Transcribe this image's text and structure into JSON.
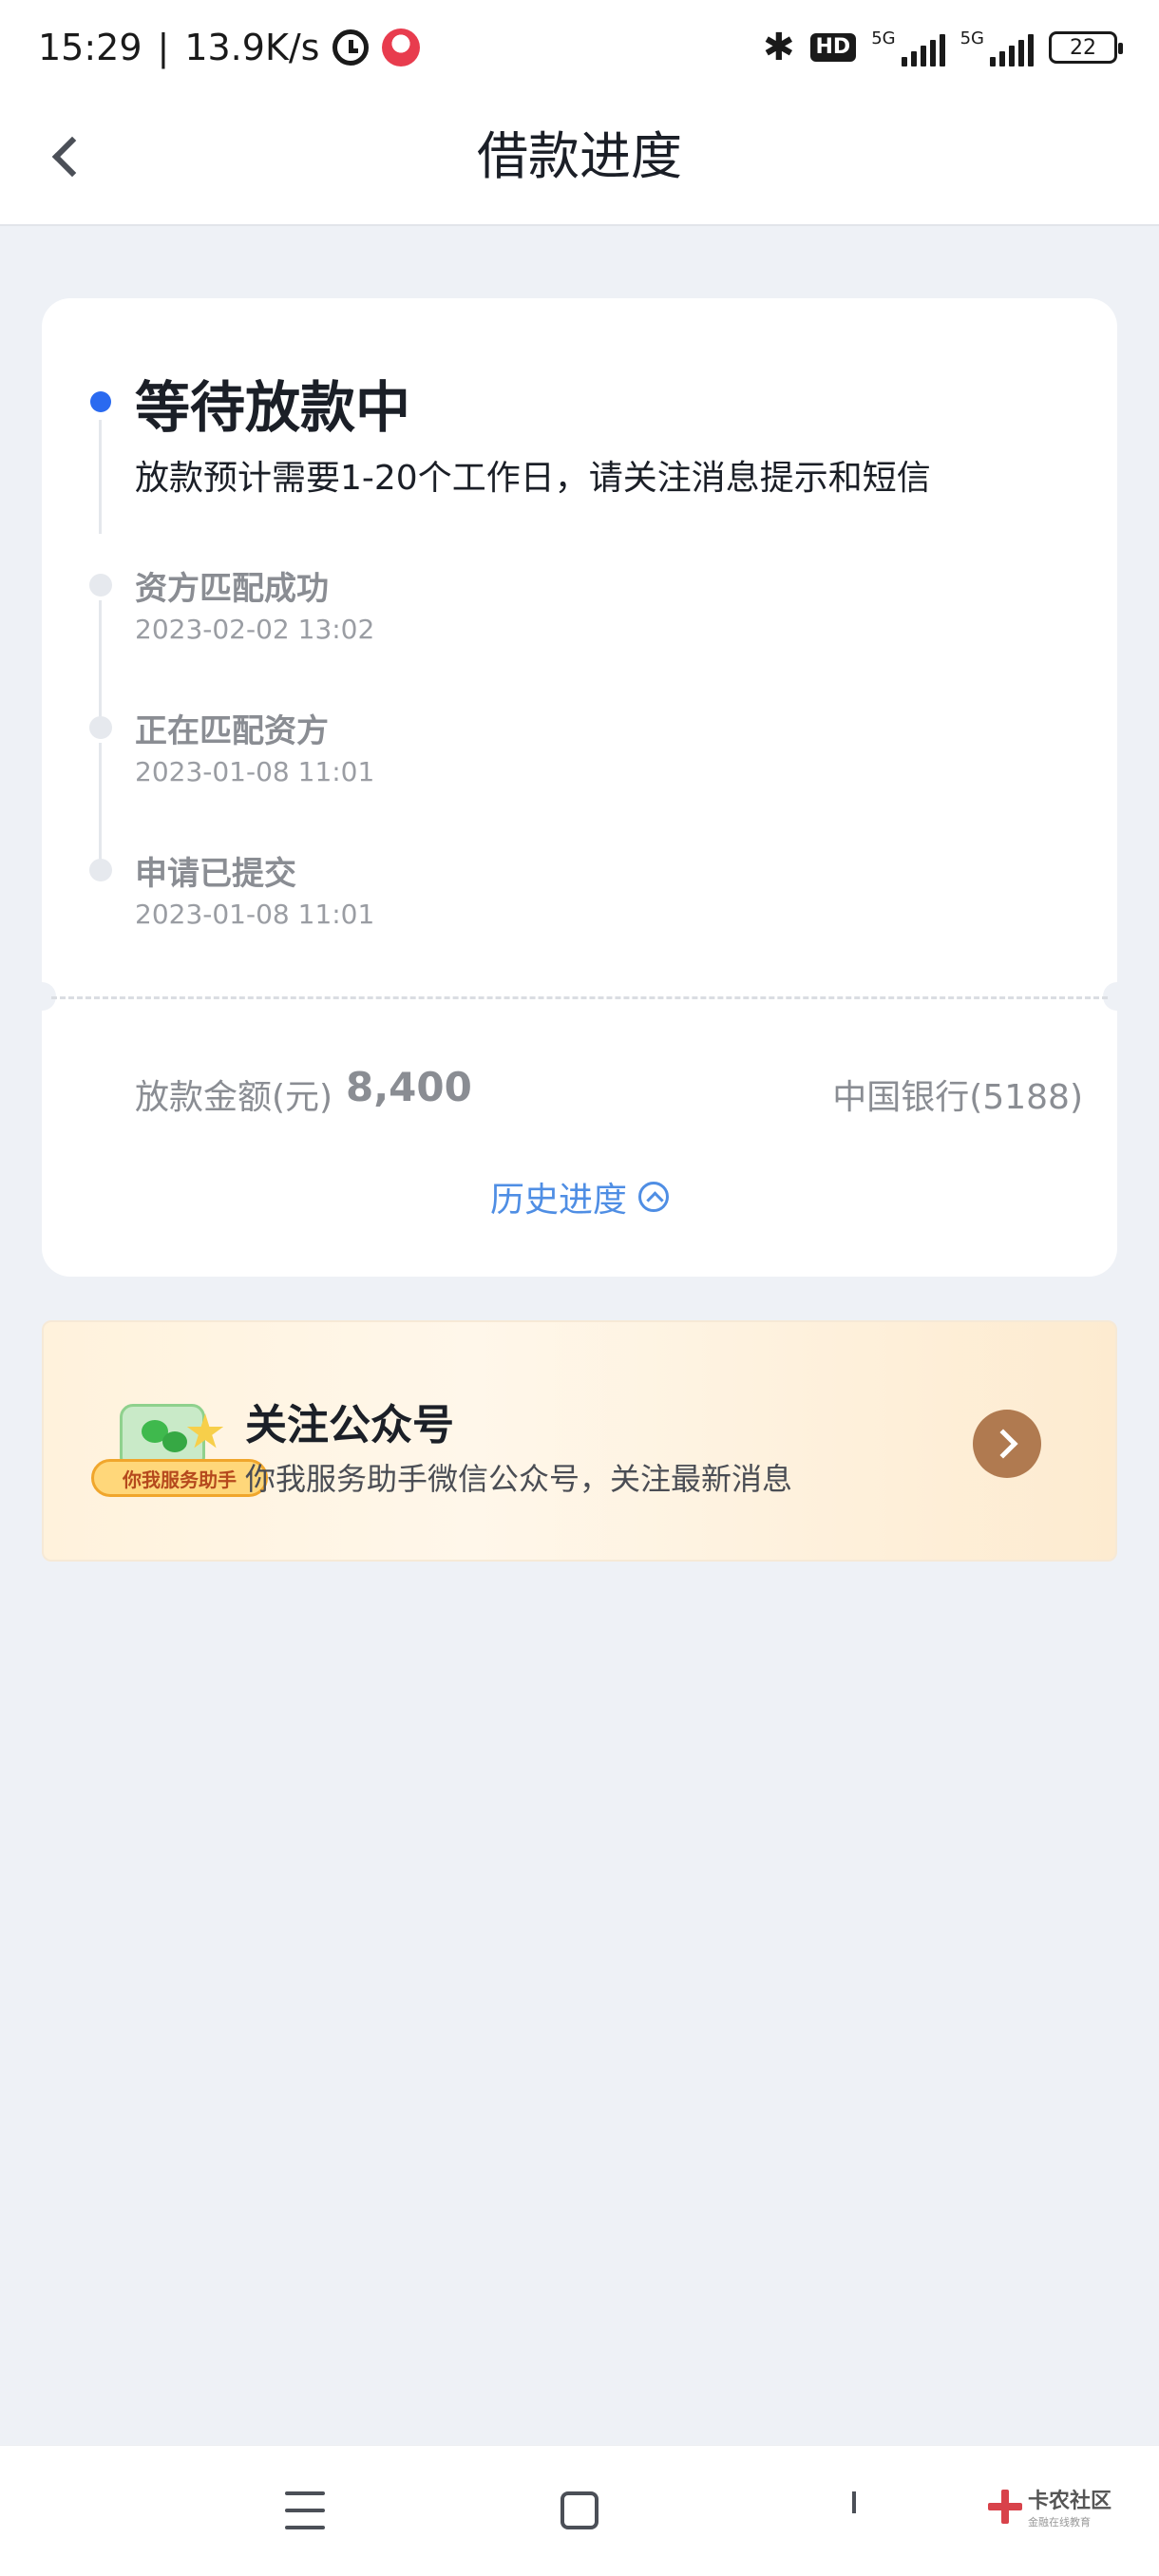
{
  "status_bar": {
    "time": "15:29",
    "separator": "|",
    "net_speed": "13.9K/s",
    "network_label_1": "5G",
    "network_label_2": "5G",
    "hd_label": "HD",
    "battery": "22"
  },
  "header": {
    "title": "借款进度"
  },
  "progress": {
    "current_status": "等待放款中",
    "current_desc": "放款预计需要1-20个工作日，请关注消息提示和短信",
    "steps": [
      {
        "title": "资方匹配成功",
        "time": "2023-02-02 13:02"
      },
      {
        "title": "正在匹配资方",
        "time": "2023-01-08 11:01"
      },
      {
        "title": "申请已提交",
        "time": "2023-01-08 11:01"
      }
    ],
    "amount_label": "放款金额(元)",
    "amount_value": "8,400",
    "bank": "中国银行(5188)",
    "history_label": "历史进度"
  },
  "banner": {
    "logo_tag": "你我服务助手",
    "title": "关注公众号",
    "desc": "你我服务助手微信公众号，关注最新消息"
  },
  "watermark": {
    "main": "卡农社区",
    "sub": "金融在线教育"
  },
  "colors": {
    "accent_blue": "#2a6af0",
    "link_blue": "#4f8ee4",
    "page_bg": "#eef1f6",
    "banner_arrow": "#b07a50"
  }
}
